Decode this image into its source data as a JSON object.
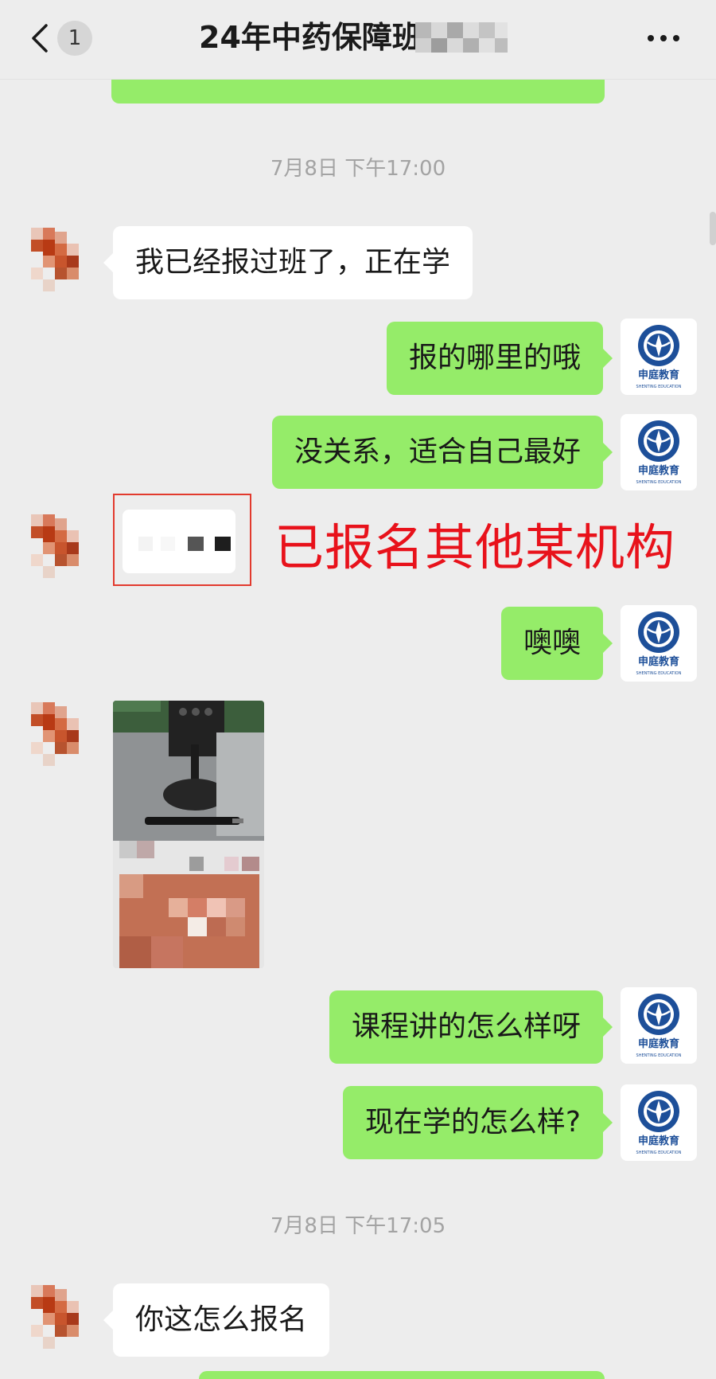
{
  "header": {
    "unread_count": "1",
    "title": "24年中药保障班"
  },
  "messages": [
    {
      "type": "time",
      "text": "7月8日 下午17:00"
    },
    {
      "type": "text",
      "side": "left",
      "text": "我已经报过班了，正在学"
    },
    {
      "type": "text",
      "side": "right",
      "text": "报的哪里的哦"
    },
    {
      "type": "text",
      "side": "right",
      "text": "没关系，适合自己最好"
    },
    {
      "type": "annotation",
      "side": "left",
      "text": "已报名其他某机构"
    },
    {
      "type": "text",
      "side": "right",
      "text": "噢噢"
    },
    {
      "type": "image",
      "side": "left"
    },
    {
      "type": "text",
      "side": "right",
      "text": "课程讲的怎么样呀"
    },
    {
      "type": "text",
      "side": "right",
      "text": "现在学的怎么样?"
    },
    {
      "type": "time",
      "text": "7月8日 下午17:05"
    },
    {
      "type": "text",
      "side": "left",
      "text": "你这怎么报名"
    }
  ],
  "brand_avatar": {
    "name_cn": "申庭教育",
    "name_en": "SHENTING EDUCATION"
  },
  "colors": {
    "background": "#ededed",
    "bubble_self": "#95ec69",
    "bubble_other": "#ffffff",
    "annotation": "#e8121b"
  }
}
